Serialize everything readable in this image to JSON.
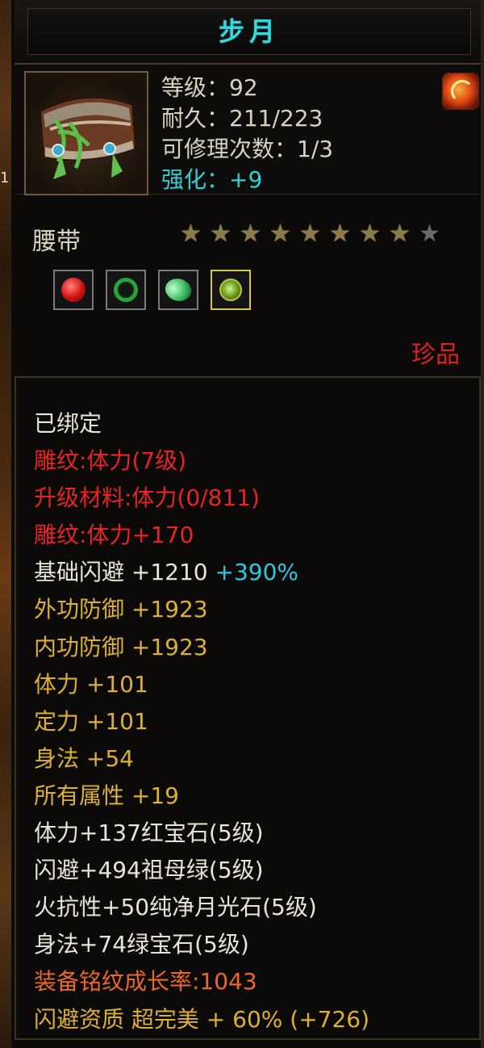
{
  "title": "步月",
  "stats": {
    "level": "等级：92",
    "durability": "耐久：211/223",
    "repair": "可修理次数：1/3",
    "enhance": "强化：+9"
  },
  "left_edge_text": "1",
  "item_type": "腰带",
  "stars": {
    "filled": 8,
    "total": 9
  },
  "gems": [
    {
      "name": "ruby-gem",
      "selected": false
    },
    {
      "name": "emerald-gem",
      "selected": false
    },
    {
      "name": "moonstone-gem",
      "selected": false
    },
    {
      "name": "green-gem",
      "selected": true
    }
  ],
  "rarity": "珍品",
  "attributes": {
    "bound": "已绑定",
    "engrave_1": "雕纹:体力(7级)",
    "upgrade_material": "升级材料:体力(0/811)",
    "engrave_2": "雕纹:体力+170",
    "dodge_label": "基础闪避  +1210",
    "dodge_bonus": "+390%",
    "outer_def": "外功防御  +1923",
    "inner_def": "内功防御  +1923",
    "stamina": "体力  +101",
    "focus": "定力  +101",
    "agility": "身法  +54",
    "all_attr": "所有属性  +19",
    "gem_1": "体力+137红宝石(5级)",
    "gem_2": "闪避+494祖母绿(5级)",
    "gem_3": "火抗性+50纯净月光石(5级)",
    "gem_4": "身法+74绿宝石(5级)",
    "growth": "装备铭纹成长率:1043",
    "quality": "闪避资质  超完美  + 60%  (+726)"
  },
  "colors": {
    "title": "#36d8de",
    "white": "#e8e4d8",
    "red": "#e82424",
    "gold": "#dcb030",
    "cyan": "#30c8e0",
    "orange": "#e86a24"
  }
}
